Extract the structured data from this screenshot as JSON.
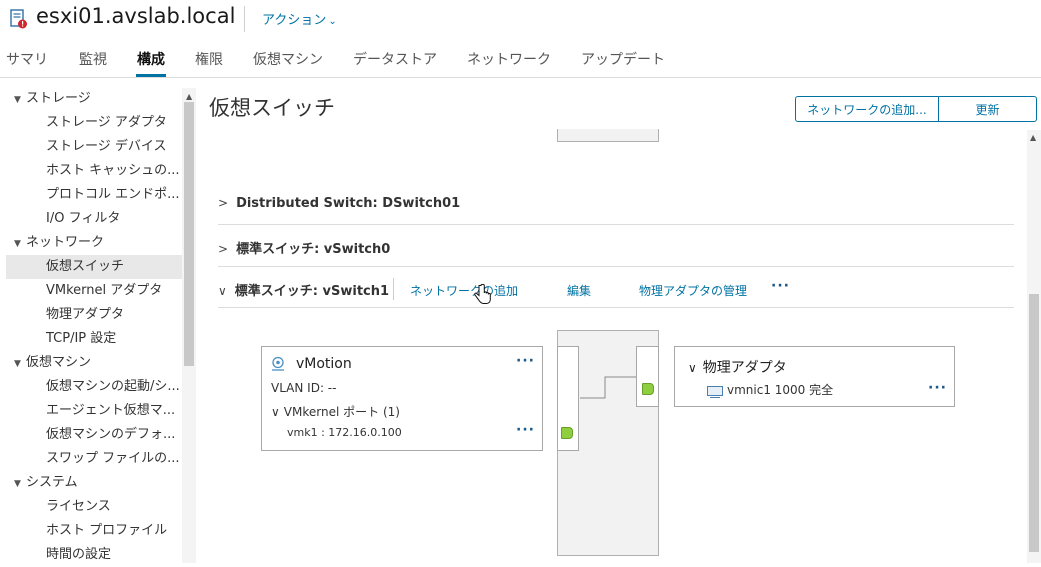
{
  "header": {
    "title": "esxi01.avslab.local",
    "actions_label": "アクション",
    "chevron_icon": "chevron-down-icon",
    "host_icon": "host-alert-icon"
  },
  "tabs": [
    {
      "label": "サマリ"
    },
    {
      "label": "監視"
    },
    {
      "label": "構成",
      "active": true
    },
    {
      "label": "権限"
    },
    {
      "label": "仮想マシン"
    },
    {
      "label": "データストア"
    },
    {
      "label": "ネットワーク"
    },
    {
      "label": "アップデート"
    }
  ],
  "sidebar": {
    "items": [
      {
        "label": "ストレージ",
        "group": true
      },
      {
        "label": "ストレージ アダプタ"
      },
      {
        "label": "ストレージ デバイス"
      },
      {
        "label": "ホスト キャッシュの..."
      },
      {
        "label": "プロトコル エンドポ..."
      },
      {
        "label": "I/O フィルタ"
      },
      {
        "label": "ネットワーク",
        "group": true
      },
      {
        "label": "仮想スイッチ",
        "selected": true
      },
      {
        "label": "VMkernel アダプタ"
      },
      {
        "label": "物理アダプタ"
      },
      {
        "label": "TCP/IP 設定"
      },
      {
        "label": "仮想マシン",
        "group": true
      },
      {
        "label": "仮想マシンの起動/シ..."
      },
      {
        "label": "エージェント仮想マ..."
      },
      {
        "label": "仮想マシンのデフォ..."
      },
      {
        "label": "スワップ ファイルの..."
      },
      {
        "label": "システム",
        "group": true
      },
      {
        "label": "ライセンス"
      },
      {
        "label": "ホスト プロファイル"
      },
      {
        "label": "時間の設定"
      }
    ]
  },
  "main": {
    "title": "仮想スイッチ",
    "add_network_button": "ネットワークの追加...",
    "refresh_button": "更新",
    "rows": {
      "dswitch": "Distributed Switch: DSwitch01",
      "vswitch0": "標準スイッチ: vSwitch0",
      "vswitch1": "標準スイッチ: vSwitch1"
    },
    "vswitch1_actions": {
      "add_network": "ネットワークの追加",
      "edit": "編集",
      "manage_physical": "物理アダプタの管理",
      "more": "..."
    },
    "portgroup": {
      "name": "vMotion",
      "vlan": "VLAN ID: --",
      "vmk_ports": "VMkernel ポート (1)",
      "vmk1": "vmk1 : 172.16.0.100",
      "icon": "portgroup-icon"
    },
    "uplinks": {
      "title": "物理アダプタ",
      "nic": "vmnic1 1000 完全",
      "nic_icon": "nic-icon"
    }
  },
  "colors": {
    "link": "#0072a3",
    "port": "#8fcf3f",
    "alert": "#d0262d"
  }
}
